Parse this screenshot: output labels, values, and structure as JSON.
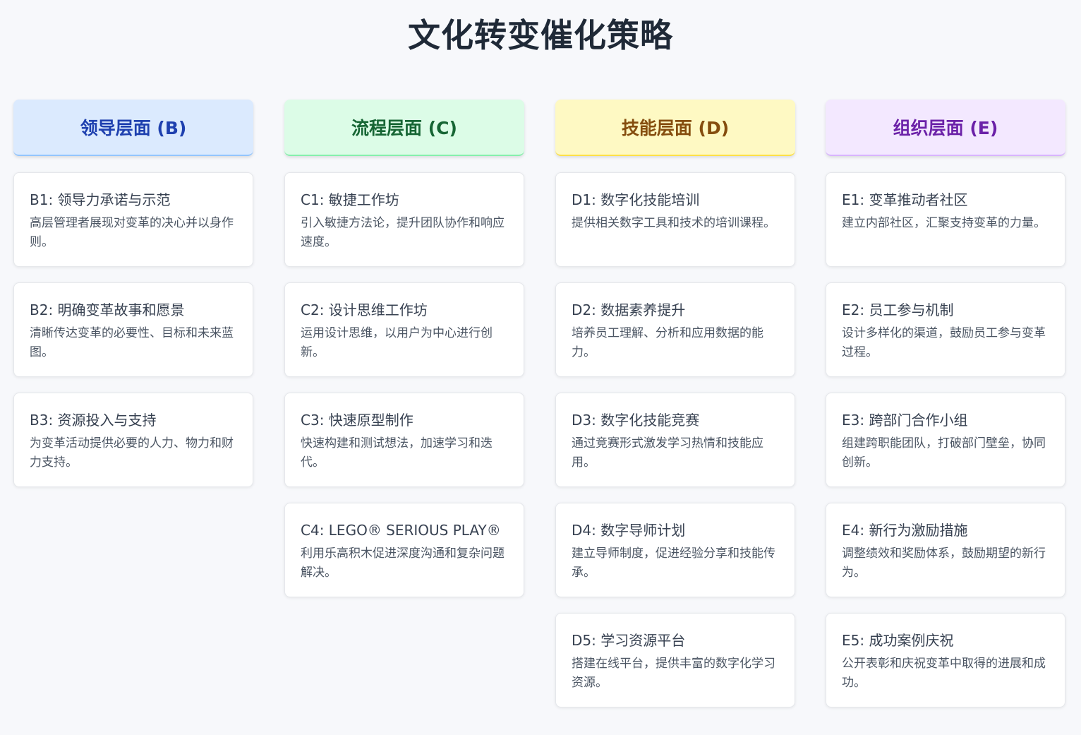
{
  "title": "文化转变催化策略",
  "columns": [
    {
      "header": "领导层面 (B)",
      "color": "#dbeafe",
      "cards": [
        {
          "title": "B1: 领导力承诺与示范",
          "desc": "高层管理者展现对变革的决心并以身作则。"
        },
        {
          "title": "B2: 明确变革故事和愿景",
          "desc": "清晰传达变革的必要性、目标和未来蓝图。"
        },
        {
          "title": "B3: 资源投入与支持",
          "desc": "为变革活动提供必要的人力、物力和财力支持。"
        }
      ]
    },
    {
      "header": "流程层面 (C)",
      "color": "#dcfce7",
      "cards": [
        {
          "title": "C1: 敏捷工作坊",
          "desc": "引入敏捷方法论，提升团队协作和响应速度。"
        },
        {
          "title": "C2: 设计思维工作坊",
          "desc": "运用设计思维，以用户为中心进行创新。"
        },
        {
          "title": "C3: 快速原型制作",
          "desc": "快速构建和测试想法，加速学习和迭代。"
        },
        {
          "title": "C4: LEGO® SERIOUS PLAY®",
          "desc": "利用乐高积木促进深度沟通和复杂问题解决。"
        }
      ]
    },
    {
      "header": "技能层面 (D)",
      "color": "#fef9c3",
      "cards": [
        {
          "title": "D1: 数字化技能培训",
          "desc": "提供相关数字工具和技术的培训课程。"
        },
        {
          "title": "D2: 数据素养提升",
          "desc": "培养员工理解、分析和应用数据的能力。"
        },
        {
          "title": "D3: 数字化技能竞赛",
          "desc": "通过竞赛形式激发学习热情和技能应用。"
        },
        {
          "title": "D4: 数字导师计划",
          "desc": "建立导师制度，促进经验分享和技能传承。"
        },
        {
          "title": "D5: 学习资源平台",
          "desc": "搭建在线平台，提供丰富的数字化学习资源。"
        }
      ]
    },
    {
      "header": "组织层面 (E)",
      "color": "#f3e8ff",
      "cards": [
        {
          "title": "E1: 变革推动者社区",
          "desc": "建立内部社区，汇聚支持变革的力量。"
        },
        {
          "title": "E2: 员工参与机制",
          "desc": "设计多样化的渠道，鼓励员工参与变革过程。"
        },
        {
          "title": "E3: 跨部门合作小组",
          "desc": "组建跨职能团队，打破部门壁垒，协同创新。"
        },
        {
          "title": "E4: 新行为激励措施",
          "desc": "调整绩效和奖励体系，鼓励期望的新行为。"
        },
        {
          "title": "E5: 成功案例庆祝",
          "desc": "公开表彰和庆祝变革中取得的进展和成功。"
        }
      ]
    }
  ]
}
